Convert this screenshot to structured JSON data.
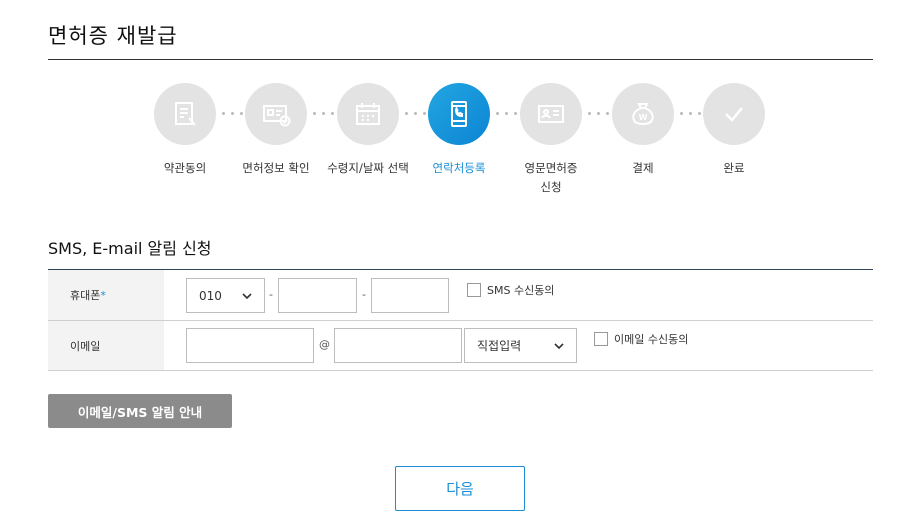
{
  "page": {
    "title": "면허증 재발급"
  },
  "steps": [
    {
      "label": "약관동의",
      "icon": "document-pen-icon",
      "active": false
    },
    {
      "label": "면허정보 확인",
      "icon": "id-card-check-icon",
      "active": false
    },
    {
      "label": "수령지/날짜 선택",
      "icon": "calendar-icon",
      "active": false
    },
    {
      "label": "연락처등록",
      "icon": "phone-icon",
      "active": true
    },
    {
      "label": "영문면허증",
      "label2": "신청",
      "icon": "id-card-icon",
      "active": false
    },
    {
      "label": "결제",
      "icon": "money-bag-icon",
      "active": false
    },
    {
      "label": "완료",
      "icon": "check-icon",
      "active": false
    }
  ],
  "section": {
    "title": "SMS, E-mail 알림 신청"
  },
  "phone_row": {
    "label": "휴대폰",
    "required_mark": "*",
    "prefix_value": "010",
    "separator": "-",
    "sms_consent_label": "SMS 수신동의"
  },
  "email_row": {
    "label": "이메일",
    "at_sign": "@",
    "domain_select": "직접입력",
    "email_consent_label": "이메일 수신동의"
  },
  "buttons": {
    "notice": "이메일/SMS 알림 안내",
    "next": "다음"
  },
  "colors": {
    "accent": "#1a8ed4",
    "step_inactive": "#e3e3e3",
    "notice_button": "#8b8b8b"
  }
}
